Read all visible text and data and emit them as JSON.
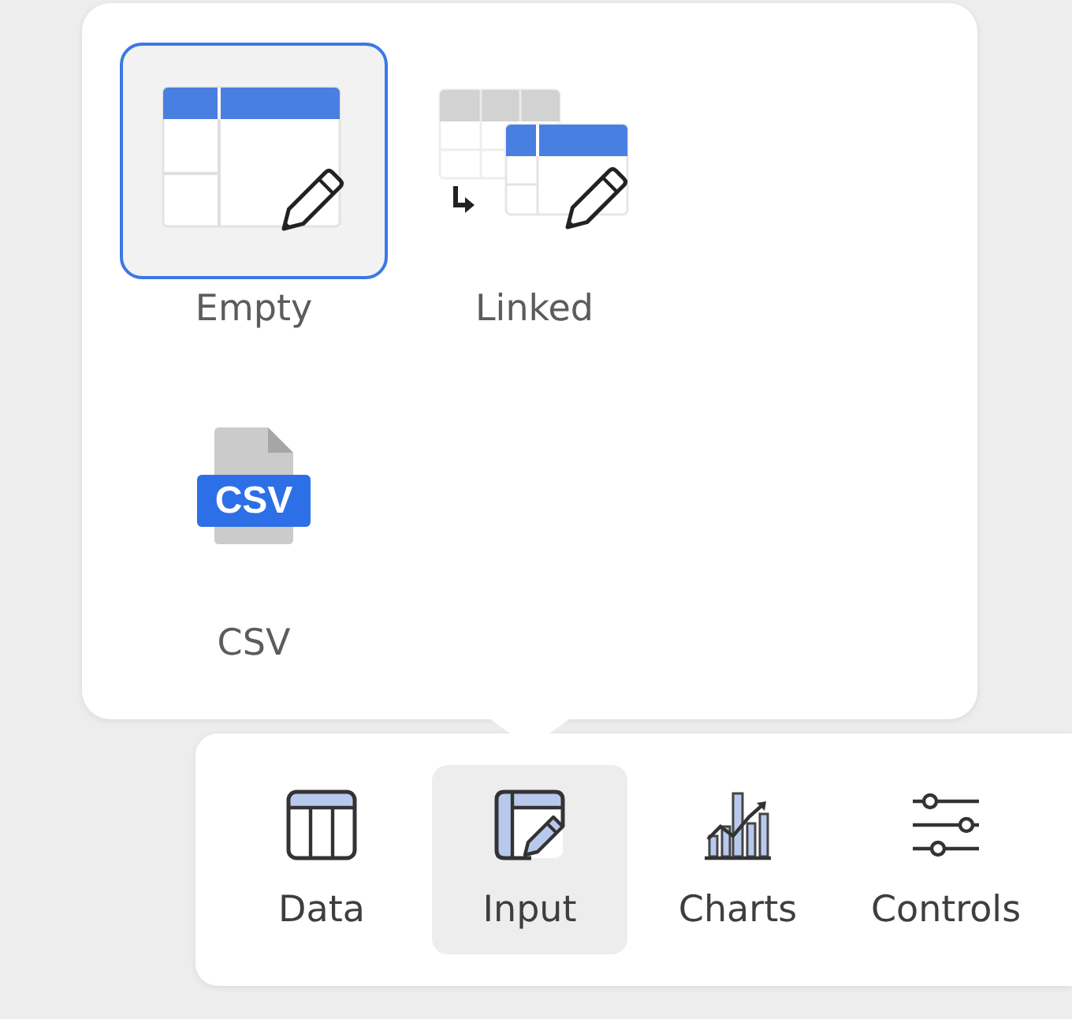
{
  "popup": {
    "options": [
      {
        "kind": "empty",
        "label": "Empty",
        "selected": true
      },
      {
        "kind": "linked",
        "label": "Linked",
        "selected": false
      },
      {
        "kind": "csv",
        "label": "CSV",
        "badge": "CSV",
        "selected": false
      }
    ]
  },
  "toolbar": {
    "items": [
      {
        "kind": "data",
        "label": "Data",
        "selected": false
      },
      {
        "kind": "input",
        "label": "Input",
        "selected": true
      },
      {
        "kind": "charts",
        "label": "Charts",
        "selected": false
      },
      {
        "kind": "controls",
        "label": "Controls",
        "selected": false
      }
    ]
  }
}
